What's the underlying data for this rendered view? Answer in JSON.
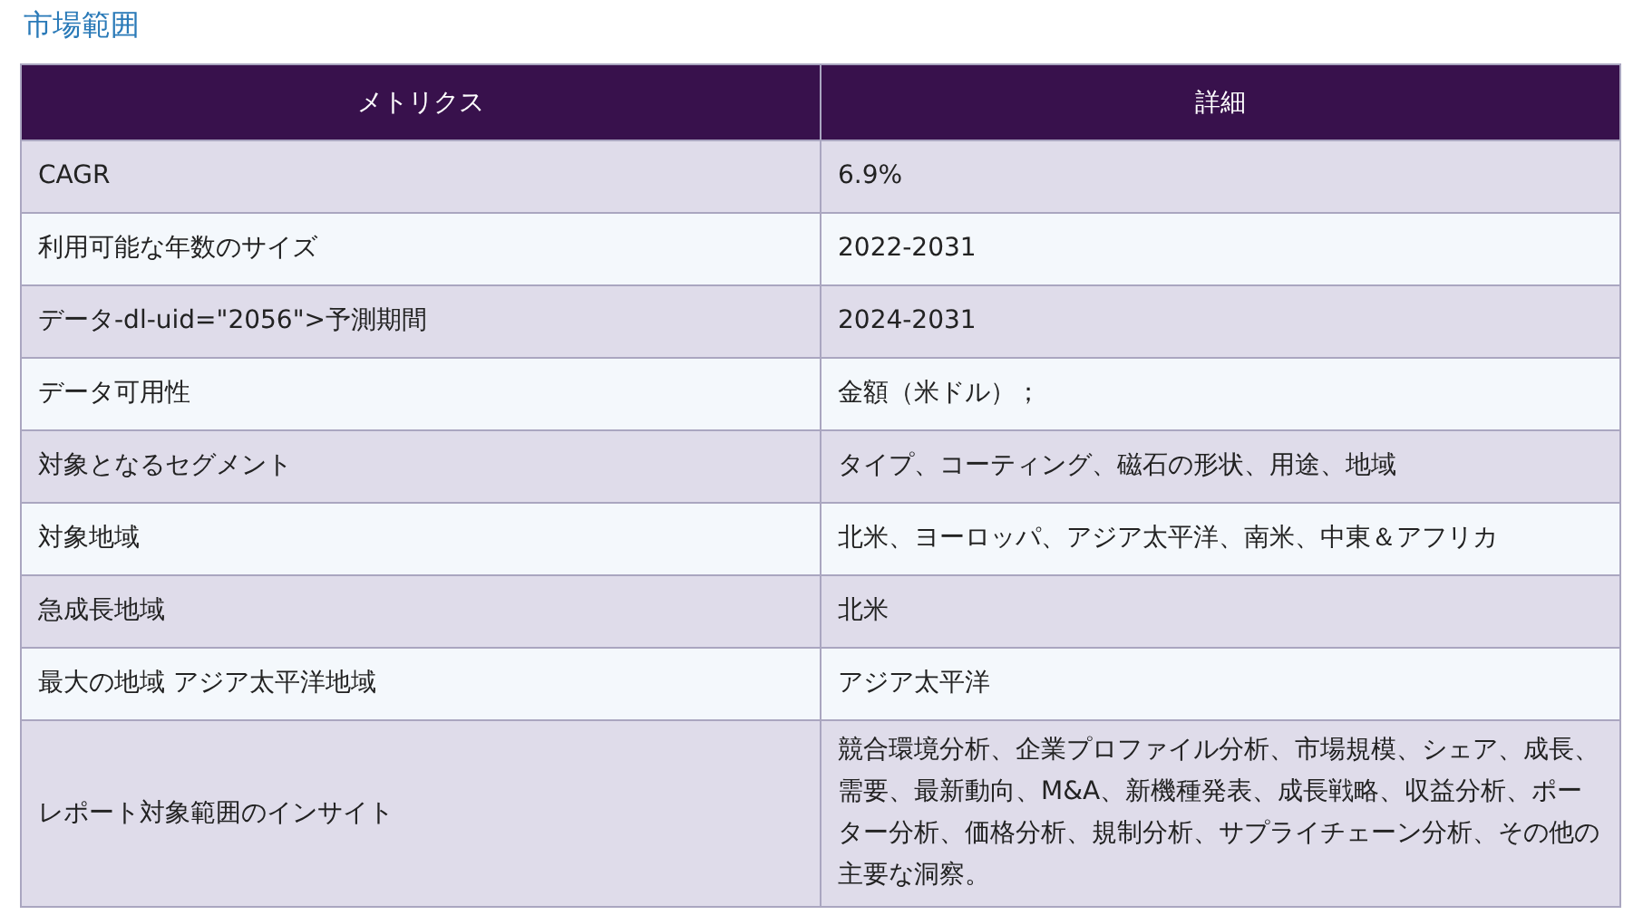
{
  "heading": "市場範囲",
  "table": {
    "columns": [
      "メトリクス",
      "詳細"
    ],
    "rows": [
      {
        "metric": "CAGR",
        "detail": "6.9%"
      },
      {
        "metric": "利用可能な年数のサイズ",
        "detail": "2022-2031"
      },
      {
        "metric": "データ-dl-uid=\"2056\">予測期間",
        "detail": "2024-2031"
      },
      {
        "metric": "データ可用性",
        "detail": "金額（米ドル）；"
      },
      {
        "metric": "対象となるセグメント",
        "detail": "タイプ、コーティング、磁石の形状、用途、地域"
      },
      {
        "metric": "対象地域",
        "detail": "北米、ヨーロッパ、アジア太平洋、南米、中東＆アフリカ"
      },
      {
        "metric": "急成長地域",
        "detail": "北米"
      },
      {
        "metric": "最大の地域 アジア太平洋地域",
        "detail": "アジア太平洋"
      },
      {
        "metric": "レポート対象範囲のインサイト",
        "detail": "競合環境分析、企業プロファイル分析、市場規模、シェア、成長、需要、最新動向、M&A、新機種発表、成長戦略、収益分析、ポーター分析、価格分析、規制分析、サプライチェーン分析、その他の主要な洞察。"
      }
    ]
  }
}
